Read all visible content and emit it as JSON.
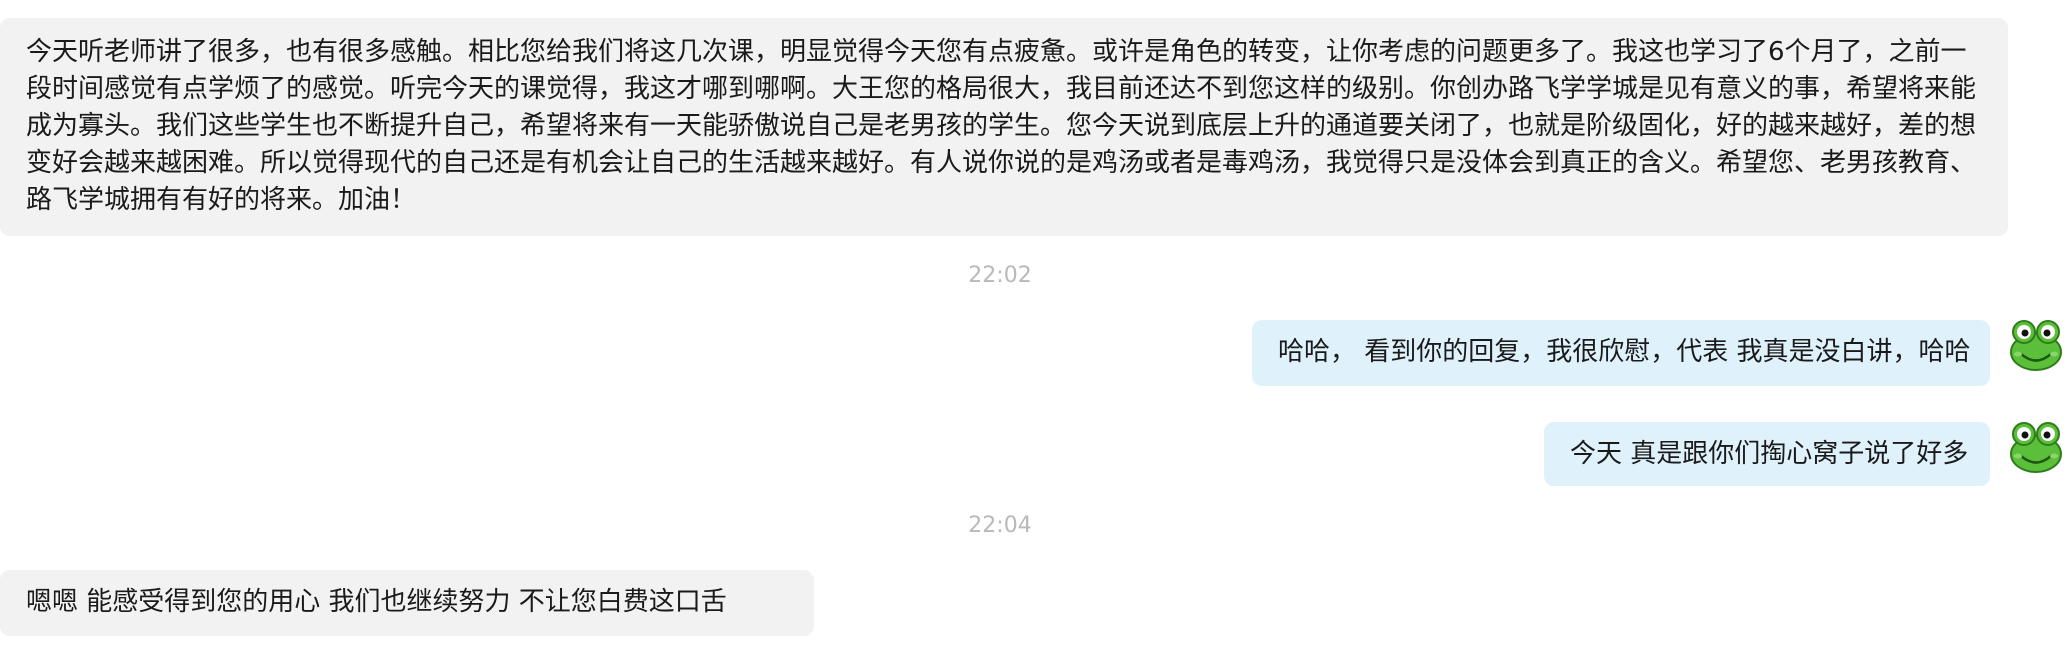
{
  "chat": {
    "messages": [
      {
        "side": "left",
        "text": "今天听老师讲了很多，也有很多感触。相比您给我们将这几次课，明显觉得今天您有点疲惫。或许是角色的转变，让你考虑的问题更多了。我这也学习了6个月了，之前一段时间感觉有点学烦了的感觉。听完今天的课觉得，我这才哪到哪啊。大王您的格局很大，我目前还达不到您这样的级别。你创办路飞学学城是见有意义的事，希望将来能成为寡头。我们这些学生也不断提升自己，希望将来有一天能骄傲说自己是老男孩的学生。您今天说到底层上升的通道要关闭了，也就是阶级固化，好的越来越好，差的想变好会越来越困难。所以觉得现代的自己还是有机会让自己的生活越来越好。有人说你说的是鸡汤或者是毒鸡汤，我觉得只是没体会到真正的含义。希望您、老男孩教育、路飞学城拥有有好的将来。加油！"
      },
      {
        "timestamp": "22:02"
      },
      {
        "side": "right",
        "text": "哈哈，  看到你的回复，我很欣慰，代表 我真是没白讲，哈哈",
        "avatar_icon": "frog-avatar-icon"
      },
      {
        "side": "right",
        "text": "今天 真是跟你们掏心窝子说了好多",
        "avatar_icon": "frog-avatar-icon"
      },
      {
        "timestamp": "22:04"
      },
      {
        "side": "left",
        "text": "嗯嗯 能感受得到您的用心  我们也继续努力  不让您白费这口舌"
      }
    ]
  },
  "colors": {
    "left_bubble": "#f2f2f2",
    "right_bubble": "#dff1fb",
    "timestamp": "#b9b9b9",
    "text": "#1a1a1a",
    "avatar_green": "#5cbf3a"
  }
}
